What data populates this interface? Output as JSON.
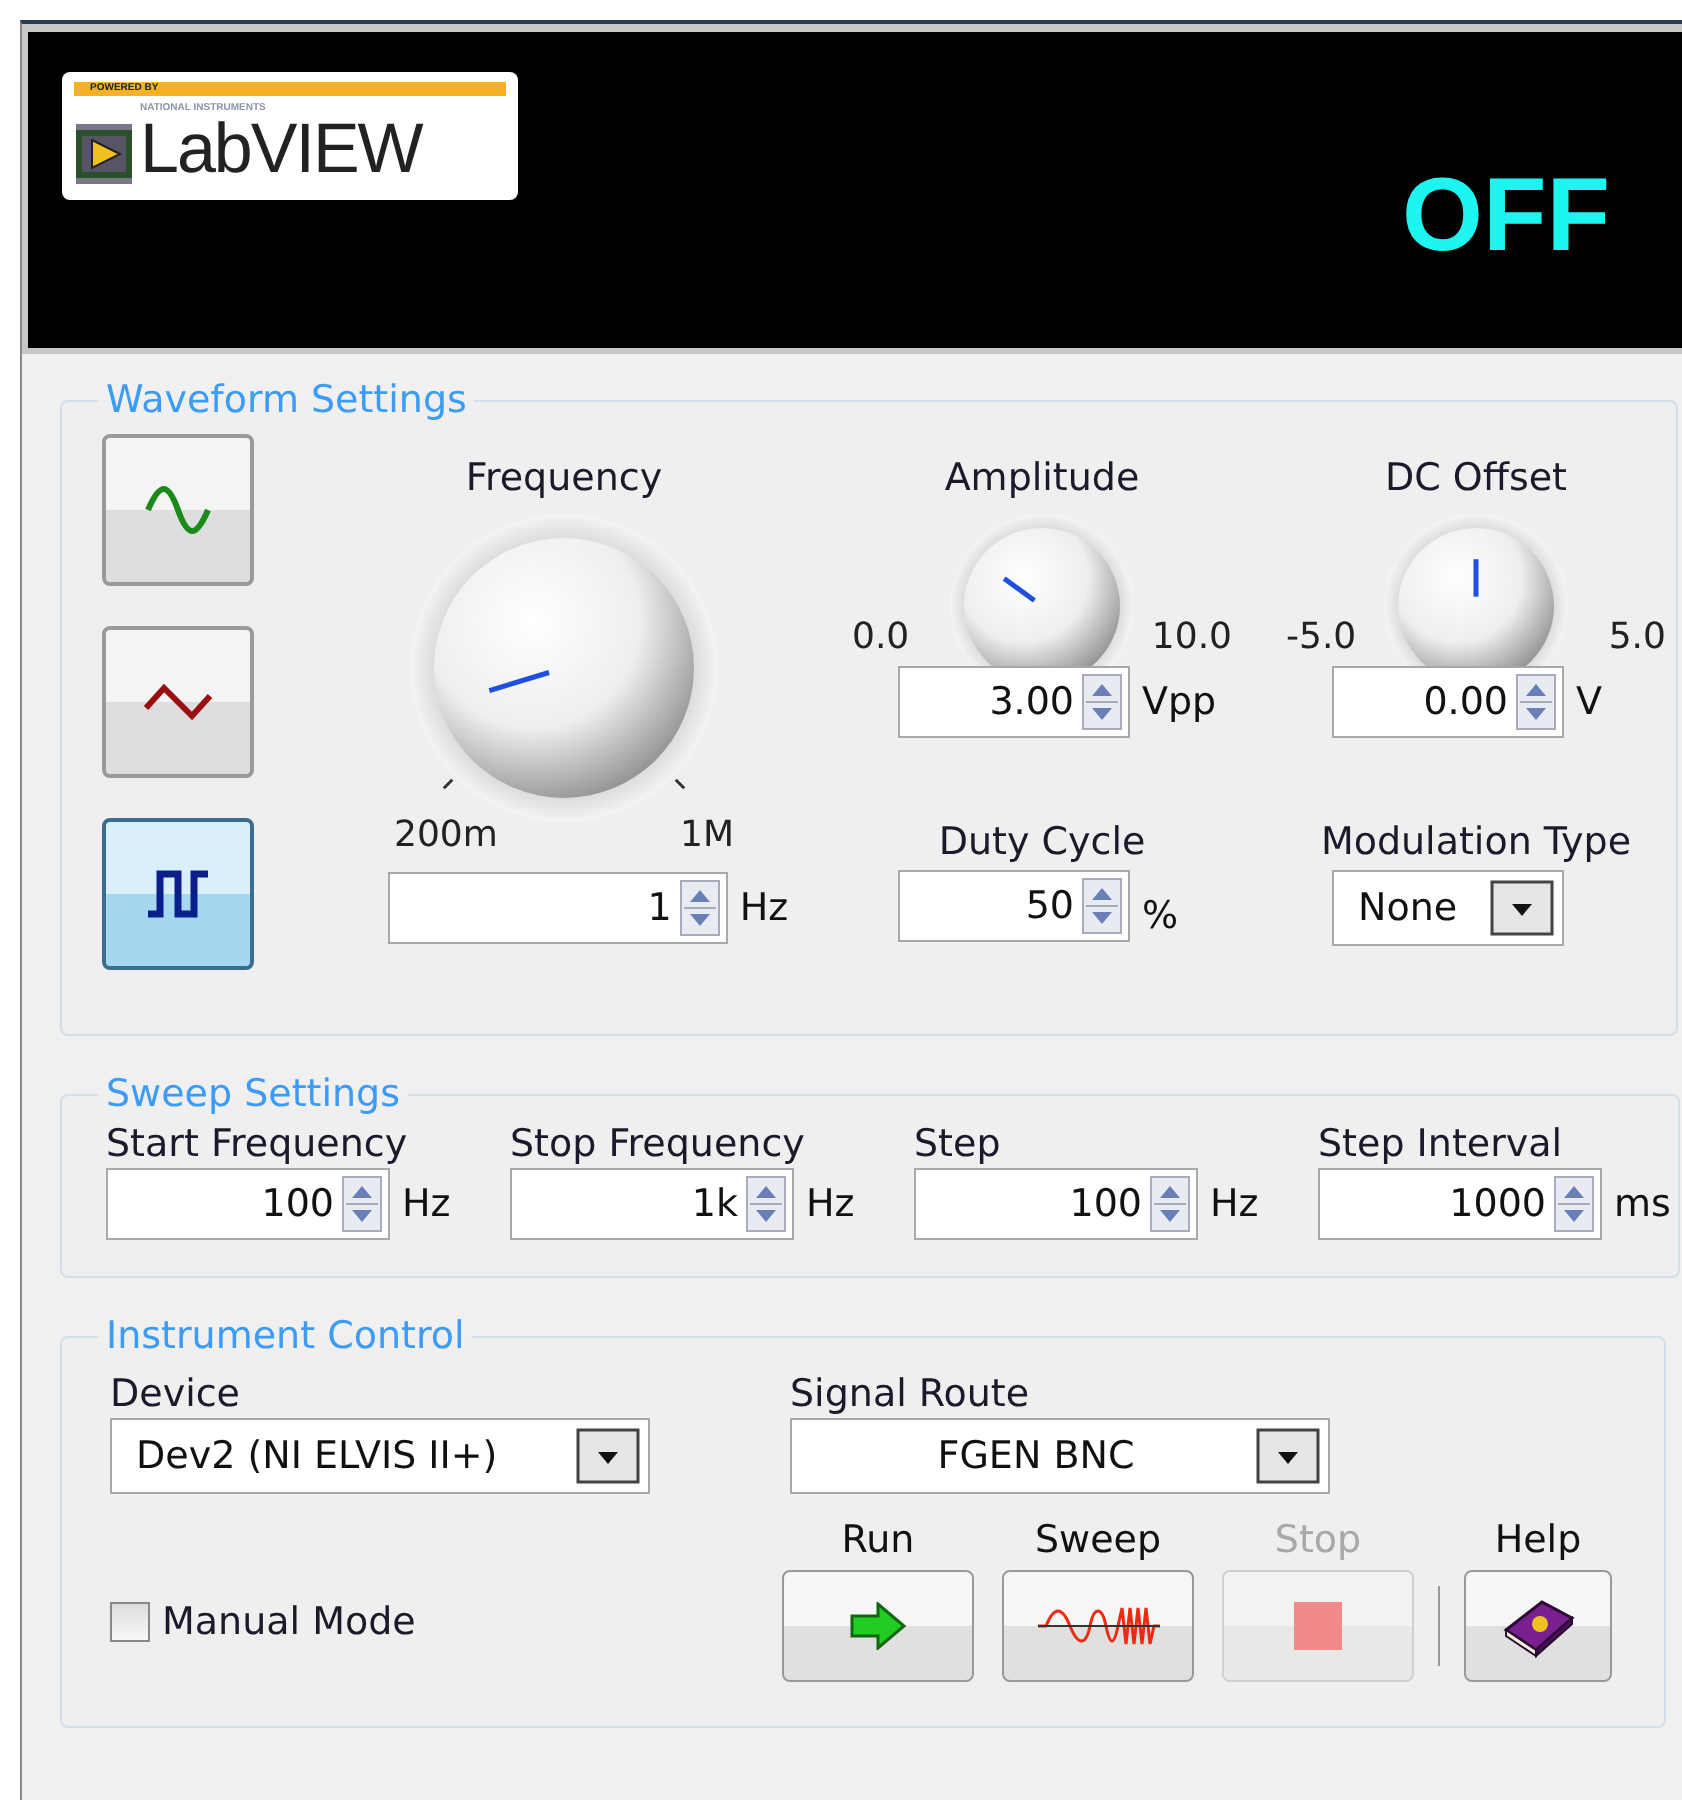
{
  "header": {
    "logo": {
      "tagline": "POWERED BY",
      "maker": "NATIONAL INSTRUMENTS",
      "name": "LabVIEW"
    },
    "status": "OFF"
  },
  "waveform_settings": {
    "title": "Waveform Settings",
    "shapes": [
      {
        "kind": "sine",
        "selected": false
      },
      {
        "kind": "triangle",
        "selected": false
      },
      {
        "kind": "square",
        "selected": true
      }
    ],
    "frequency": {
      "label": "Frequency",
      "min": "200m",
      "max": "1M",
      "value": "1",
      "unit": "Hz"
    },
    "amplitude": {
      "label": "Amplitude",
      "min": "0.0",
      "max": "10.0",
      "value": "3.00",
      "unit": "Vpp"
    },
    "dc_offset": {
      "label": "DC Offset",
      "min": "-5.0",
      "max": "5.0",
      "value": "0.00",
      "unit": "V"
    },
    "duty_cycle": {
      "label": "Duty Cycle",
      "value": "50",
      "unit": "%"
    },
    "modulation_type": {
      "label": "Modulation Type",
      "value": "None"
    }
  },
  "sweep_settings": {
    "title": "Sweep Settings",
    "fields": [
      {
        "label": "Start Frequency",
        "value": "100",
        "unit": "Hz"
      },
      {
        "label": "Stop Frequency",
        "value": "1k",
        "unit": "Hz"
      },
      {
        "label": "Step",
        "value": "100",
        "unit": "Hz"
      },
      {
        "label": "Step Interval",
        "value": "1000",
        "unit": "ms"
      }
    ]
  },
  "instrument_control": {
    "title": "Instrument Control",
    "device": {
      "label": "Device",
      "value": "Dev2 (NI ELVIS II+)"
    },
    "signal_route": {
      "label": "Signal Route",
      "value": "FGEN BNC"
    },
    "manual_mode": {
      "label": "Manual Mode",
      "checked": false
    },
    "buttons": [
      {
        "kind": "run",
        "label": "Run",
        "disabled": false
      },
      {
        "kind": "sweep",
        "label": "Sweep",
        "disabled": false
      },
      {
        "kind": "stop",
        "label": "Stop",
        "disabled": true
      },
      {
        "kind": "help",
        "label": "Help",
        "disabled": false
      }
    ]
  }
}
